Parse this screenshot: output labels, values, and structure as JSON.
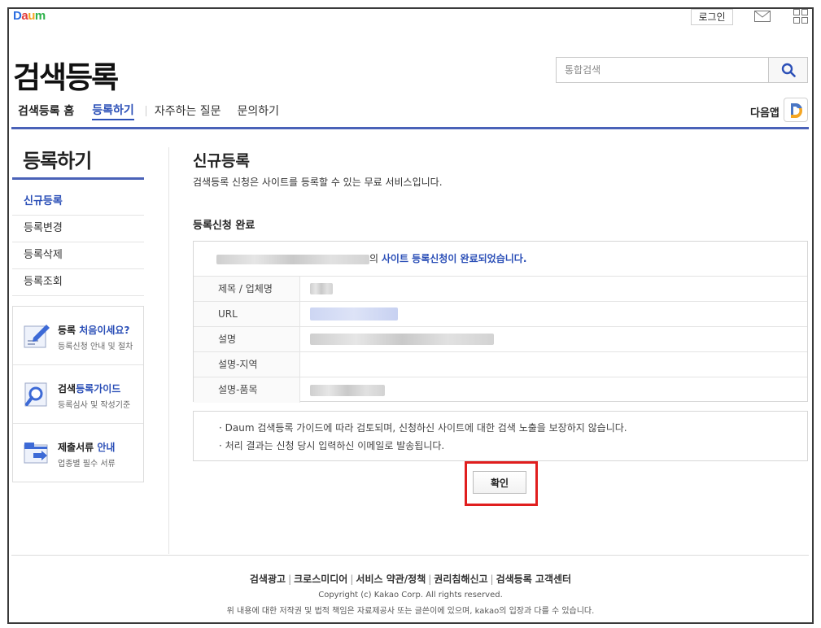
{
  "header": {
    "logo": [
      "D",
      "a",
      "u",
      "m"
    ],
    "login_label": "로그인",
    "site_title": "검색등록",
    "search_placeholder": "통합검색",
    "app_label": "다음앱"
  },
  "nav": {
    "home": "검색등록 홈",
    "register": "등록하기",
    "faq": "자주하는 질문",
    "inquiry": "문의하기"
  },
  "sidebar": {
    "title": "등록하기",
    "items": [
      {
        "label": "신규등록",
        "active": true
      },
      {
        "label": "등록변경",
        "active": false
      },
      {
        "label": "등록삭제",
        "active": false
      },
      {
        "label": "등록조회",
        "active": false
      }
    ],
    "promos": [
      {
        "title_a": "등록 ",
        "title_b": "처음이세요?",
        "sub": "등록신청 안내 및 절차",
        "icon": "pencil-document-icon"
      },
      {
        "title_a": "검색",
        "title_b": "등록가이드",
        "sub": "등록심사 및 작성기준",
        "icon": "magnifier-document-icon"
      },
      {
        "title_a": "제출서류 ",
        "title_b": "안내",
        "sub": "업종별 필수 서류",
        "icon": "folder-arrow-icon"
      }
    ]
  },
  "main": {
    "title": "신규등록",
    "desc": "검색등록 신청은 사이트를 등록할 수 있는 무료 서비스입니다.",
    "section_title": "등록신청 완료",
    "result_suffix": "의",
    "result_message": "사이트 등록신청이 완료되었습니다.",
    "rows": [
      {
        "label": "제목 / 업체명"
      },
      {
        "label": "URL"
      },
      {
        "label": "설명"
      },
      {
        "label": "설명-지역"
      },
      {
        "label": "설명-품목"
      }
    ],
    "notes": [
      "· Daum 검색등록 가이드에 따라 검토되며, 신청하신 사이트에 대한 검색 노출을 보장하지 않습니다.",
      "· 처리 결과는 신청 당시 입력하신 이메일로 발송됩니다."
    ],
    "confirm_label": "확인"
  },
  "footer": {
    "links": [
      "검색광고",
      "크로스미디어",
      "서비스 약관/정책",
      "권리침해신고",
      "검색등록 고객센터"
    ],
    "copyright": "Copyright (c) Kakao Corp. All rights reserved.",
    "disclaimer": "위 내용에 대한 저작권 및 법적 책임은 자료제공사 또는 글쓴이에 있으며, kakao의 입장과 다를 수 있습니다."
  },
  "colors": {
    "accent": "#2b4fb7",
    "rule": "#4a62b8",
    "highlight": "#e01e1e"
  }
}
